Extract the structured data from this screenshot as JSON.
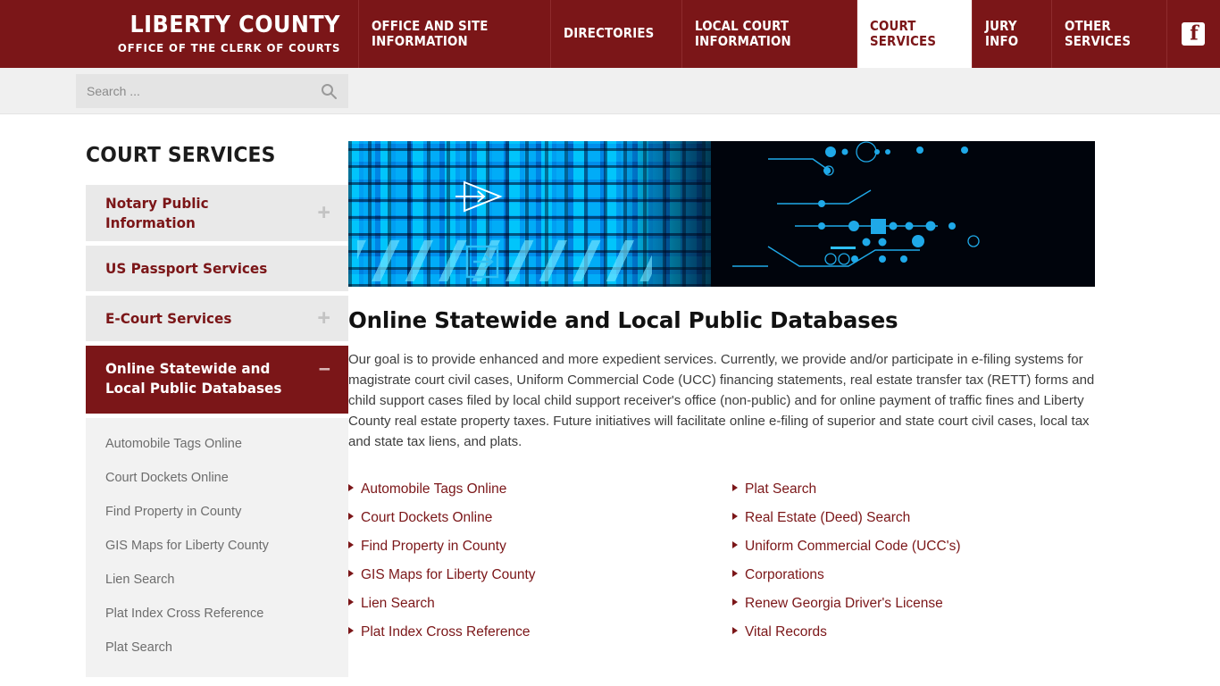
{
  "header": {
    "brand_title": "LIBERTY COUNTY",
    "brand_subtitle": "OFFICE OF THE CLERK OF COURTS",
    "brand_color": "#7B1618",
    "nav": [
      {
        "label": "OFFICE AND SITE INFORMATION",
        "active": false
      },
      {
        "label": "DIRECTORIES",
        "active": false
      },
      {
        "label": "LOCAL COURT INFORMATION",
        "active": false
      },
      {
        "label": "COURT SERVICES",
        "active": true
      },
      {
        "label": "JURY INFO",
        "active": false
      },
      {
        "label": "OTHER SERVICES",
        "active": false
      }
    ],
    "social_icon": "facebook-icon"
  },
  "search": {
    "placeholder": "Search ...",
    "value": "",
    "icon": "search-icon"
  },
  "sidebar": {
    "title": "COURT SERVICES",
    "menu": [
      {
        "label": "Notary Public Information",
        "toggle": "+",
        "active": false
      },
      {
        "label": "US Passport Services",
        "toggle": "",
        "active": false
      },
      {
        "label": "E-Court Services",
        "toggle": "+",
        "active": false
      },
      {
        "label": "Online Statewide and Local Public Databases",
        "toggle": "−",
        "active": true
      }
    ],
    "submenu": [
      "Automobile Tags Online",
      "Court Dockets Online",
      "Find Property in County",
      "GIS Maps for Liberty County",
      "Lien Search",
      "Plat Index Cross Reference",
      "Plat Search"
    ]
  },
  "main": {
    "banner_alt": "abstract blue digital technology circuitry banner",
    "title": "Online Statewide and Local Public Databases",
    "paragraph": "Our goal is to provide enhanced and more expedient services. Currently, we provide and/or participate in e-filing systems for magistrate court civil cases, Uniform Commercial Code (UCC) financing statements, real estate transfer tax (RETT) forms and child support cases filed by local child support receiver's office (non-public) and for online payment of traffic fines and Liberty County real estate property taxes. Future initiatives will facilitate online e-filing of superior and state court civil cases, local tax and state tax liens, and plats.",
    "links_left": [
      "Automobile Tags Online",
      "Court Dockets Online",
      "Find Property in County",
      "GIS Maps for Liberty County",
      "Lien Search",
      "Plat Index Cross Reference"
    ],
    "links_right": [
      "Plat Search",
      "Real Estate (Deed) Search",
      "Uniform Commercial Code (UCC's)",
      "Corporations",
      "Renew Georgia Driver's License",
      "Vital Records"
    ]
  }
}
